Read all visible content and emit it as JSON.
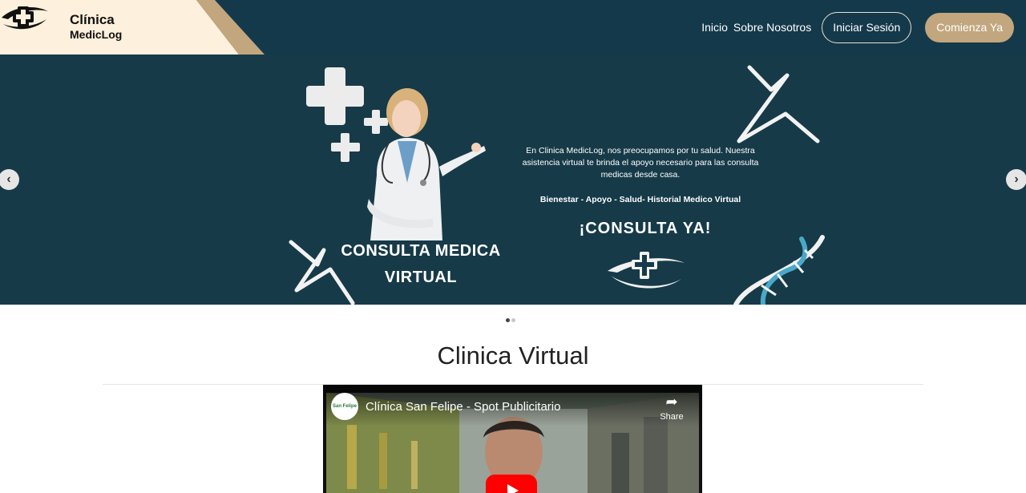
{
  "brand": {
    "line1": "Clínica",
    "line2": "MedicLog"
  },
  "nav": {
    "links": [
      "Inicio",
      "Sobre Nosotros"
    ],
    "login_label": "Iniciar Sesión",
    "cta_label": "Comienza Ya"
  },
  "hero": {
    "description": "En Clinica MedicLog, nos preocupamos por tu salud. Nuestra asistencia virtual te brinda el apoyo necesario para las consulta medicas desde casa.",
    "tags": "Bienestar - Apoyo - Salud- Historial Medico Virtual",
    "cta": "¡CONSULTA YA!",
    "title_line1": "CONSULTA MEDICA",
    "title_line2": "VIRTUAL",
    "prev_glyph": "‹",
    "next_glyph": "›"
  },
  "carousel": {
    "slide_count": 2,
    "active_index": 0
  },
  "section": {
    "title": "Clinica Virtual"
  },
  "video": {
    "title": "Clínica San Felipe - Spot Publicitario",
    "channel_badge": "San Felipe",
    "share_label": "Share",
    "share_glyph": "➦"
  },
  "colors": {
    "navbar_bg": "#14394a",
    "hero_bg": "#163a48",
    "brand_panel": "#fdf0dc",
    "accent": "#c2a67e",
    "dna_blue": "#4aa8c8"
  },
  "icons": {
    "logo": "medical-cross-logo-icon",
    "prev": "chevron-left-icon",
    "next": "chevron-right-icon",
    "share": "share-icon",
    "play": "play-icon"
  }
}
